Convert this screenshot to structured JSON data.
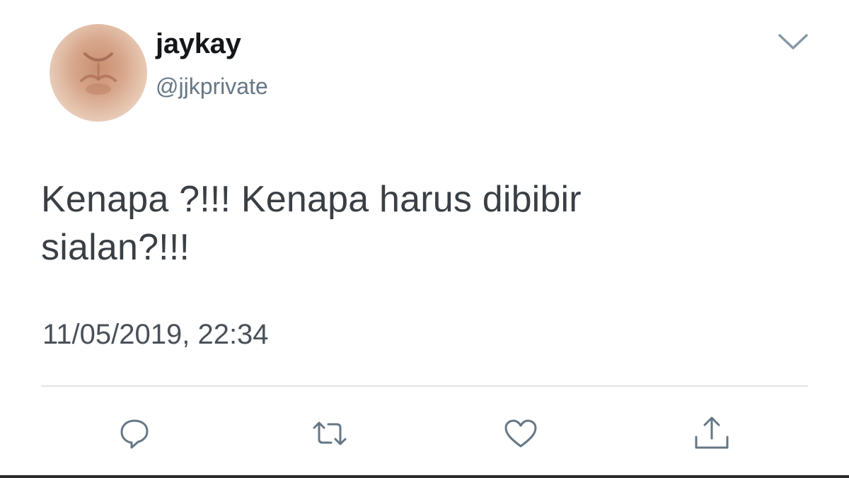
{
  "tweet": {
    "display_name": "jaykay",
    "handle": "@jjkprivate",
    "text_line1": "Kenapa ?!!! Kenapa harus dibibir",
    "text_line2": "sialan?!!!",
    "timestamp": "11/05/2019, 22:34"
  },
  "icons": {
    "menu": "chevron-down-icon",
    "reply": "reply-bubble-icon",
    "retweet": "retweet-icon",
    "like": "heart-icon",
    "share": "share-icon"
  },
  "colors": {
    "name": "#14171a",
    "handle": "#657786",
    "text": "#3a3f45",
    "icon": "#657786",
    "divider": "#dfe3e6"
  }
}
